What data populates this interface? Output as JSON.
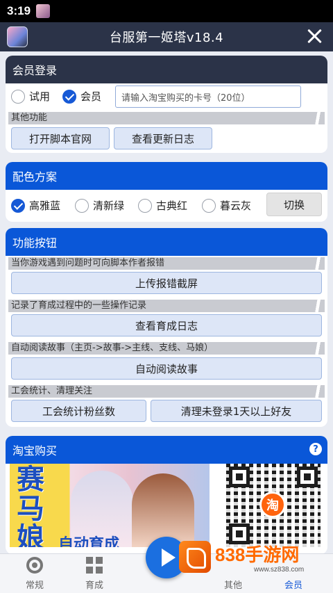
{
  "status_bar": {
    "time": "3:19"
  },
  "header": {
    "title": "台服第一姬塔v18.4"
  },
  "member_login": {
    "title": "会员登录",
    "options": [
      {
        "label": "试用",
        "checked": false
      },
      {
        "label": "会员",
        "checked": true
      }
    ],
    "card_input_placeholder": "请输入淘宝购买的卡号（20位）",
    "other_section": "其他功能",
    "buttons": [
      "打开脚本官网",
      "查看更新日志"
    ]
  },
  "color_scheme": {
    "title": "配色方案",
    "options": [
      {
        "label": "高雅蓝",
        "checked": true
      },
      {
        "label": "清新绿",
        "checked": false
      },
      {
        "label": "古典红",
        "checked": false
      },
      {
        "label": "暮云灰",
        "checked": false
      }
    ],
    "switch_label": "切换"
  },
  "functions": {
    "title": "功能按钮",
    "sections": [
      {
        "caption": "当你游戏遇到问题时可向脚本作者报错",
        "buttons": [
          "上传报错截屏"
        ]
      },
      {
        "caption": "记录了育成过程中的一些操作记录",
        "buttons": [
          "查看育成日志"
        ]
      },
      {
        "caption": "自动阅读故事（主页->故事->主线、支线、马娘）",
        "buttons": [
          "自动阅读故事"
        ]
      },
      {
        "caption": "工会统计、清理关注",
        "buttons": [
          "工会统计粉丝数",
          "清理未登录1天以上好友"
        ]
      }
    ]
  },
  "taobao": {
    "title": "淘宝购买",
    "help": "?",
    "banner_text": "赛马娘",
    "banner_caption": "自动育成",
    "qr_badge": "淘"
  },
  "tabs": [
    {
      "label": "常规",
      "icon": "chrome-icon"
    },
    {
      "label": "育成",
      "icon": "grid-icon"
    },
    {
      "label": "其他",
      "icon": ""
    },
    {
      "label": "会员",
      "icon": ""
    }
  ],
  "watermark": {
    "brand_num": "838",
    "brand_cn": "手游网",
    "url": "www.sz838.com"
  },
  "colors": {
    "accent": "#0a57d8",
    "dark_header": "#2b3348",
    "watermark": "#ff6a00"
  }
}
